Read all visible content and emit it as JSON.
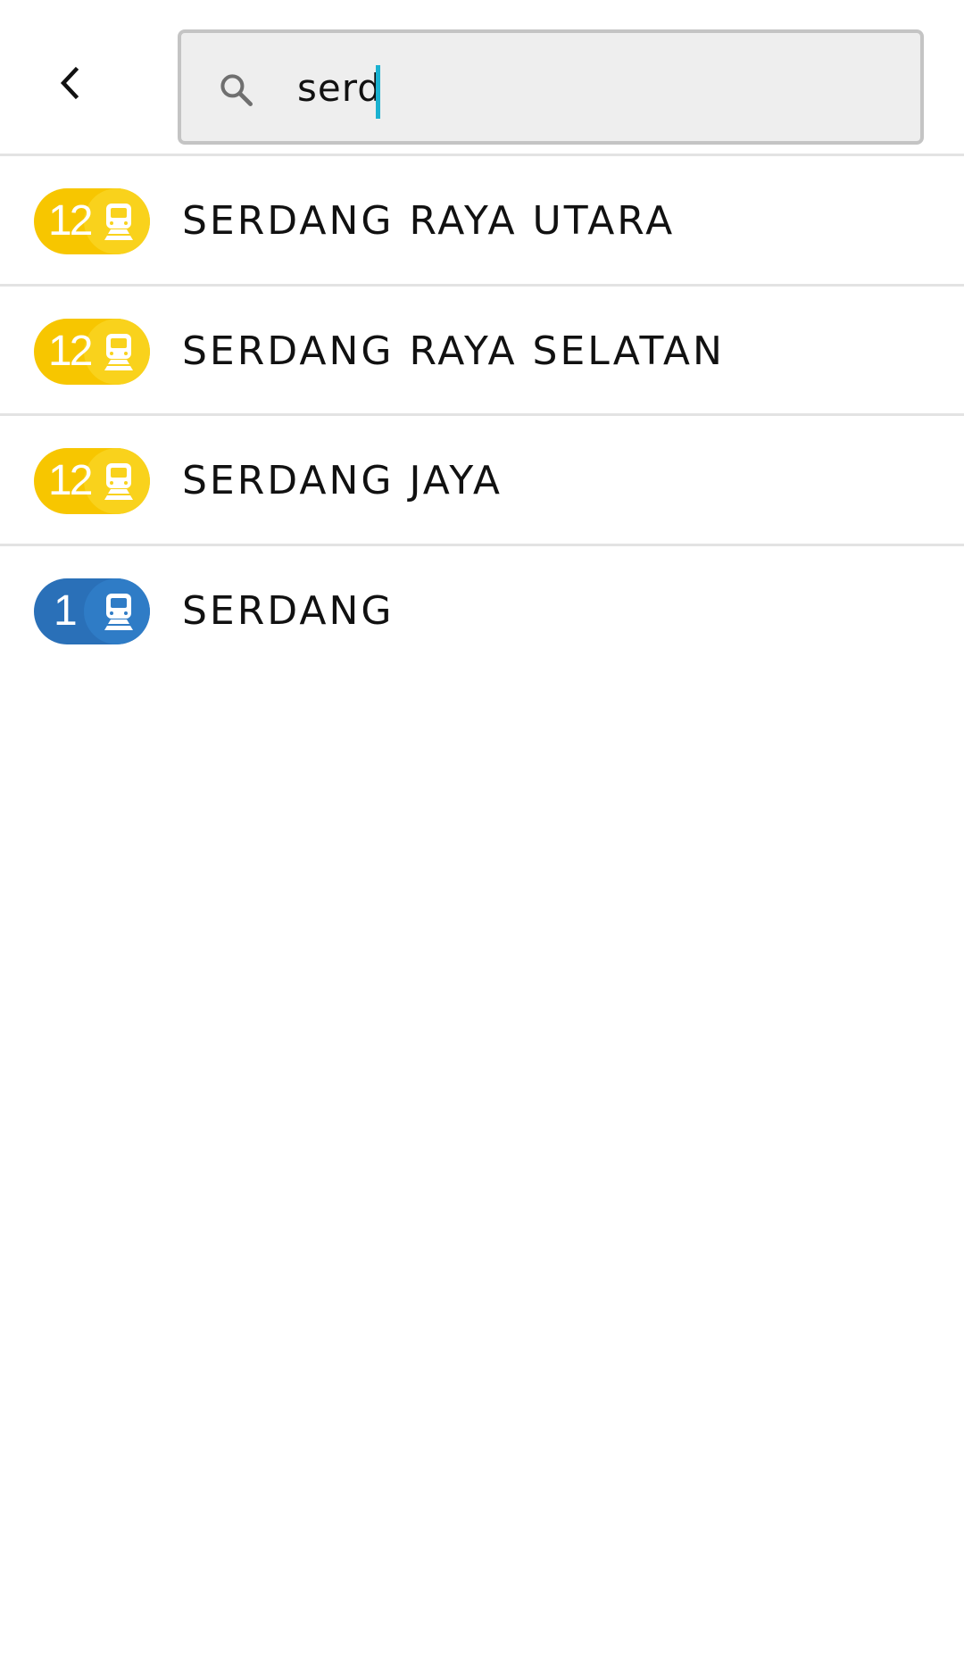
{
  "search": {
    "value": "serd",
    "placeholder": ""
  },
  "colors": {
    "accent_cursor": "#1ab1d0",
    "line_12": "#f7c600",
    "line_12_bubble": "#f9d21c",
    "line_1": "#2a70b8",
    "line_1_bubble": "#2f7cc6"
  },
  "icons": {
    "back": "chevron-left-icon",
    "search": "search-icon",
    "station": "train-icon"
  },
  "results": [
    {
      "line": "12",
      "name": "SERDANG RAYA UTARA"
    },
    {
      "line": "12",
      "name": "SERDANG RAYA SELATAN"
    },
    {
      "line": "12",
      "name": "SERDANG JAYA"
    },
    {
      "line": "1",
      "name": "SERDANG"
    }
  ]
}
